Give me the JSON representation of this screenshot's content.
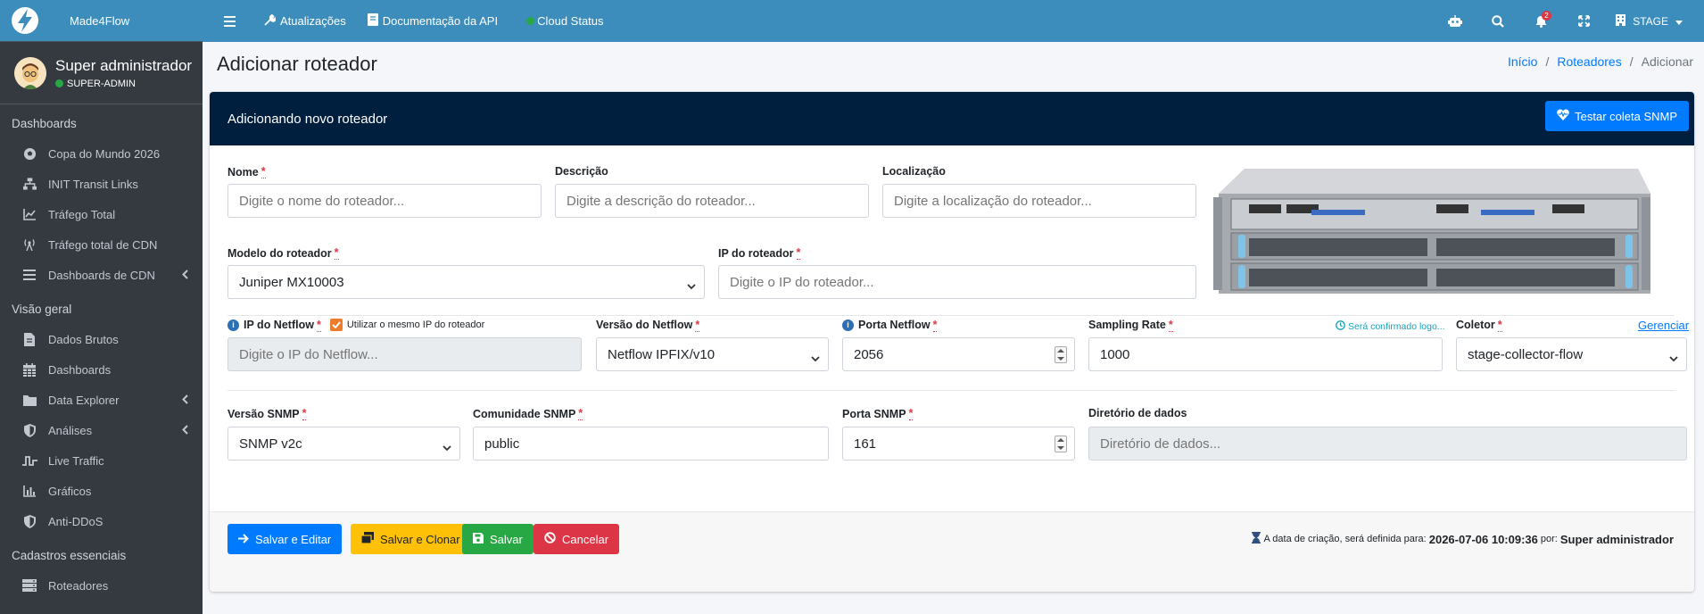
{
  "brand": {
    "name": "Made4Flow"
  },
  "user": {
    "name": "Super administrador",
    "role": "SUPER-ADMIN"
  },
  "sidebar": {
    "sections": [
      {
        "header": "Dashboards",
        "items": [
          {
            "label": "Copa do Mundo 2026",
            "icon": "soccer-ball-icon"
          },
          {
            "label": "INIT Transit Links",
            "icon": "network-icon"
          },
          {
            "label": "Tráfego Total",
            "icon": "chart-line-icon"
          },
          {
            "label": "Tráfego total de CDN",
            "icon": "broadcast-tower-icon"
          },
          {
            "label": "Dashboards de CDN",
            "icon": "bars-icon",
            "expandable": true
          }
        ]
      },
      {
        "header": "Visão geral",
        "items": [
          {
            "label": "Dados Brutos",
            "icon": "file-icon"
          },
          {
            "label": "Dashboards",
            "icon": "calendar-grid-icon"
          },
          {
            "label": "Data Explorer",
            "icon": "folder-icon",
            "expandable": true
          },
          {
            "label": "Análises",
            "icon": "shield-icon",
            "expandable": true
          },
          {
            "label": "Live Traffic",
            "icon": "wave-icon"
          },
          {
            "label": "Gráficos",
            "icon": "bar-chart-icon"
          },
          {
            "label": "Anti-DDoS",
            "icon": "shield-icon"
          }
        ]
      },
      {
        "header": "Cadastros essenciais",
        "items": [
          {
            "label": "Roteadores",
            "icon": "server-icon"
          }
        ]
      }
    ]
  },
  "topbar": {
    "links": [
      "Atualizações",
      "Documentação da API",
      "Cloud Status"
    ],
    "notification_count": "2",
    "environment": "STAGE"
  },
  "page": {
    "title": "Adicionar roteador",
    "breadcrumb": [
      "Início",
      "Roteadores",
      "Adicionar"
    ]
  },
  "card": {
    "header": "Adicionando novo roteador",
    "test_button": "Testar coleta SNMP"
  },
  "form": {
    "nome": {
      "label": "Nome",
      "placeholder": "Digite o nome do roteador..."
    },
    "descricao": {
      "label": "Descrição",
      "placeholder": "Digite a descrição do roteador..."
    },
    "localizacao": {
      "label": "Localização",
      "placeholder": "Digite a localização do roteador..."
    },
    "modelo": {
      "label": "Modelo do roteador",
      "value": "Juniper MX10003"
    },
    "ip": {
      "label": "IP do roteador",
      "placeholder": "Digite o IP do roteador..."
    },
    "ip_netflow": {
      "label": "IP do Netflow",
      "checkbox_label": "Utilizar o mesmo IP do roteador",
      "placeholder": "Digite o IP do Netflow..."
    },
    "versao_netflow": {
      "label": "Versão do Netflow",
      "value": "Netflow IPFIX/v10"
    },
    "porta_netflow": {
      "label": "Porta Netflow",
      "value": "2056"
    },
    "sampling": {
      "label": "Sampling Rate",
      "hint": "Será confirmado logo...",
      "value": "1000"
    },
    "coletor": {
      "label": "Coletor",
      "manage": "Gerenciar",
      "value": "stage-collector-flow"
    },
    "versao_snmp": {
      "label": "Versão SNMP",
      "value": "SNMP v2c"
    },
    "comunidade": {
      "label": "Comunidade SNMP",
      "value": "public"
    },
    "porta_snmp": {
      "label": "Porta SNMP",
      "value": "161"
    },
    "diretorio": {
      "label": "Diretório de dados",
      "placeholder": "Diretório de dados..."
    }
  },
  "footer": {
    "save_edit": "Salvar e Editar",
    "save_clone": "Salvar e Clonar",
    "save": "Salvar",
    "cancel": "Cancelar",
    "created_prefix": "A data de criação, será definida para:",
    "created_date": "2026-07-06 10:09:36",
    "created_by_label": "por:",
    "created_by": "Super administrador"
  },
  "colors": {
    "topbar": "#3c8dbc",
    "sidebar": "#343a40",
    "card_header": "#001f3f",
    "primary": "#007bff",
    "warning": "#ffc107",
    "success": "#28a745",
    "danger": "#dc3545"
  }
}
